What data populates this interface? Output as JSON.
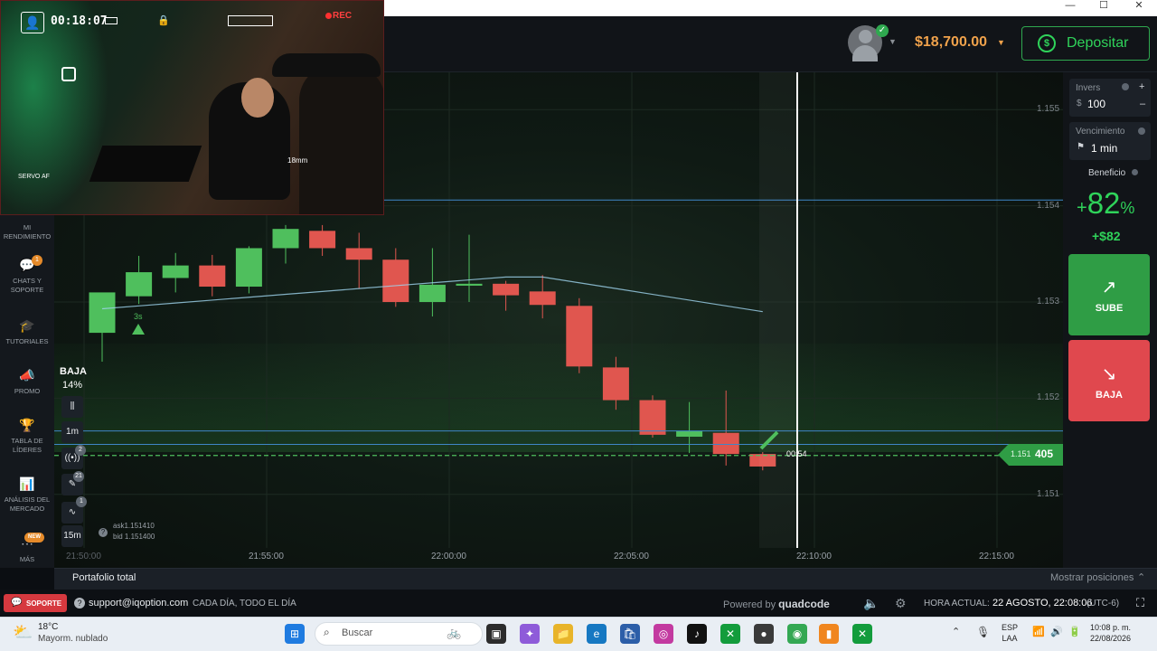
{
  "window": {
    "minimize_glyph": "—",
    "maximize_glyph": "☐",
    "close_glyph": "✕"
  },
  "header": {
    "balance": "$18,700.00",
    "deposit_label": "Depositar",
    "deposit_icon": "dollar-cycle-icon"
  },
  "sidebar": {
    "items": [
      {
        "label": "MI RENDIMIENTO",
        "icon": "chart-icon"
      },
      {
        "label": "CHATS Y SOPORTE",
        "icon": "chat-icon",
        "badge": "1"
      },
      {
        "label": "TUTORIALES",
        "icon": "graduation-cap-icon"
      },
      {
        "label": "PROMO",
        "icon": "megaphone-icon"
      },
      {
        "label": "TABLA DE LÍDERES",
        "icon": "trophy-icon"
      },
      {
        "label": "ANÁLISIS DEL MERCADO",
        "icon": "analytics-icon"
      },
      {
        "label": "MÁS",
        "icon": "more-icon",
        "badge": "NEW"
      }
    ]
  },
  "chart": {
    "baja_label": "BAJA",
    "baja_pct": "14%",
    "timer_label": "3s",
    "countdown": "00:54",
    "current_price_prefix": "1.151",
    "current_price_suffix": "405",
    "ask": "ask1.151410",
    "bid": "bid 1.151400",
    "tools": {
      "candle_type": "candle-icon",
      "timeframe": "1m",
      "indicators_badge": "2",
      "drawings_badge": "21",
      "trends_badge": "1",
      "expiry_timeframe": "15m"
    },
    "x_ticks": [
      "21:50:00",
      "21:55:00",
      "22:00:00",
      "22:05:00",
      "22:10:00",
      "22:15:00"
    ],
    "y_ticks": [
      "1.155",
      "1.154",
      "1.153",
      "1.152",
      "1.151"
    ]
  },
  "chart_data": {
    "type": "candlestick",
    "ylim": [
      1.1505,
      1.1552
    ],
    "candles": [
      {
        "o": 1.15268,
        "h": 1.153,
        "l": 1.15238,
        "c": 1.1531,
        "dir": "up"
      },
      {
        "o": 1.15306,
        "h": 1.15348,
        "l": 1.15298,
        "c": 1.15331,
        "dir": "up"
      },
      {
        "o": 1.15325,
        "h": 1.15351,
        "l": 1.1531,
        "c": 1.15338,
        "dir": "up"
      },
      {
        "o": 1.15338,
        "h": 1.15349,
        "l": 1.15306,
        "c": 1.15316,
        "dir": "down"
      },
      {
        "o": 1.15316,
        "h": 1.15358,
        "l": 1.15309,
        "c": 1.15356,
        "dir": "up"
      },
      {
        "o": 1.15356,
        "h": 1.1538,
        "l": 1.1534,
        "c": 1.15376,
        "dir": "up"
      },
      {
        "o": 1.15374,
        "h": 1.1538,
        "l": 1.15348,
        "c": 1.15356,
        "dir": "down"
      },
      {
        "o": 1.15356,
        "h": 1.15372,
        "l": 1.15314,
        "c": 1.15344,
        "dir": "down"
      },
      {
        "o": 1.15344,
        "h": 1.15356,
        "l": 1.15295,
        "c": 1.153,
        "dir": "down"
      },
      {
        "o": 1.153,
        "h": 1.15356,
        "l": 1.15285,
        "c": 1.15318,
        "dir": "up"
      },
      {
        "o": 1.15317,
        "h": 1.1537,
        "l": 1.153,
        "c": 1.15319,
        "dir": "up"
      },
      {
        "o": 1.15319,
        "h": 1.15322,
        "l": 1.15291,
        "c": 1.15307,
        "dir": "down"
      },
      {
        "o": 1.15311,
        "h": 1.15328,
        "l": 1.15283,
        "c": 1.15297,
        "dir": "down"
      },
      {
        "o": 1.15296,
        "h": 1.15304,
        "l": 1.15226,
        "c": 1.15233,
        "dir": "down"
      },
      {
        "o": 1.15232,
        "h": 1.15243,
        "l": 1.15188,
        "c": 1.15198,
        "dir": "down"
      },
      {
        "o": 1.15198,
        "h": 1.15203,
        "l": 1.15159,
        "c": 1.15162,
        "dir": "down"
      },
      {
        "o": 1.1516,
        "h": 1.15196,
        "l": 1.15143,
        "c": 1.15166,
        "dir": "up"
      },
      {
        "o": 1.15164,
        "h": 1.15208,
        "l": 1.1513,
        "c": 1.15142,
        "dir": "down"
      },
      {
        "o": 1.15142,
        "h": 1.15144,
        "l": 1.15125,
        "c": 1.15129,
        "dir": "down"
      }
    ]
  },
  "trade_panel": {
    "inversion_label": "Invers",
    "inversion_currency": "$",
    "inversion_value": "100",
    "vencimiento_label": "Vencimiento",
    "vencimiento_value": "1 min",
    "beneficio_label": "Beneficio",
    "beneficio_pct_sign": "+",
    "beneficio_pct_num": "82",
    "beneficio_pct_symbol": "%",
    "beneficio_amount": "+$82",
    "sube_label": "SUBE",
    "baja_label": "BAJA"
  },
  "bottom": {
    "portfolio": "Portafolio total",
    "positions": "Mostrar posiciones",
    "soporte": "SOPORTE",
    "email": "support@iqoption.com",
    "hours": "CADA DÍA, TODO EL DÍA",
    "powered_by": "Powered by",
    "powered_brand": "quadcode",
    "server_time_label": "HORA ACTUAL:",
    "server_time": "22 AGOSTO, 22:08:06",
    "server_tz": "(UTC-6)"
  },
  "taskbar": {
    "weather_temp": "18°C",
    "weather_desc": "Mayorm. nublado",
    "search": "Buscar",
    "lang_line1": "ESP",
    "lang_line2": "LAA",
    "time": "10:08 p. m.",
    "date": "22/08/2026"
  },
  "webcam": {
    "timer": "00:18:07",
    "rec": "REC",
    "lens": "18mm",
    "servo": "SERVO AF"
  },
  "colors": {
    "accent_green": "#2fd35a",
    "up_candle": "#4fbf5d",
    "down_candle": "#e0564f",
    "balance_orange": "#f0a24b"
  }
}
